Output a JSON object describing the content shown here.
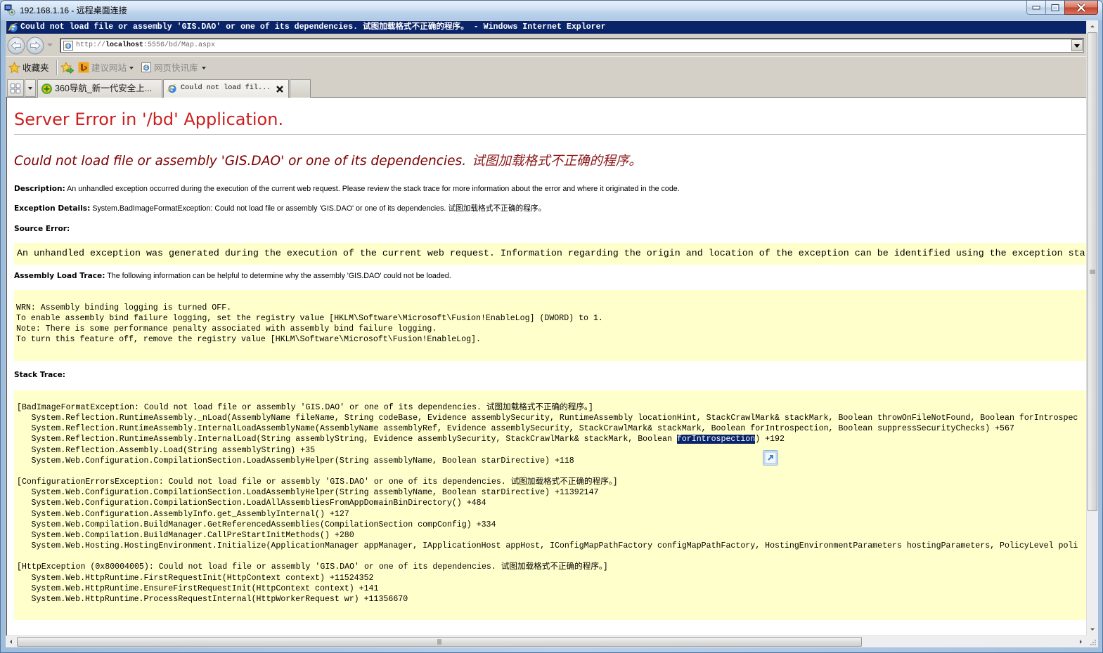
{
  "theme": {
    "heading_color": "#cc1f1f",
    "subheading_color": "#800000",
    "code_box_bg": "#ffffcc",
    "selection_bg": "#0a246a",
    "ie_titlebar_bg": "#0a246a"
  },
  "rdp_window": {
    "title": "192.168.1.16 - 远程桌面连接",
    "controls": [
      "minimize",
      "maximize",
      "close"
    ]
  },
  "ie": {
    "title": "Could not load file or assembly 'GIS.DAO' or one of its dependencies. 试图加载格式不正确的程序。 - Windows Internet Explorer",
    "address_bar": {
      "value": "http://localhost:5556/bd/Map.aspx",
      "scheme": "http://",
      "host": "localhost",
      "rest": ":5556/bd/Map.aspx"
    },
    "favorites_bar": {
      "favorites_label": "收藏夹",
      "items": [
        {
          "label": "建议网站",
          "icon": "bing-icon",
          "has_dropdown": true
        },
        {
          "label": "网页快讯库",
          "icon": "web-slice-gallery-icon",
          "has_dropdown": true
        }
      ]
    },
    "tabs": [
      {
        "label": "360导航_新一代安全上...",
        "icon": "360-icon",
        "active": false
      },
      {
        "label": "Could not load fil...",
        "icon": "ie-page-icon",
        "active": true
      }
    ]
  },
  "page": {
    "heading": "Server Error in '/bd' Application.",
    "error_title": "Could not load file or assembly 'GIS.DAO' or one of its dependencies.",
    "error_title_cn": "试图加载格式不正确的程序。",
    "description": {
      "label": "Description:",
      "text": "An unhandled exception occurred during the execution of the current web request. Please review the stack trace for more information about the error and where it originated in the code."
    },
    "exception_details": {
      "label": "Exception Details:",
      "text": "System.BadImageFormatException: Could not load file or assembly 'GIS.DAO' or one of its dependencies. 试图加载格式不正确的程序。"
    },
    "source_error": {
      "label": "Source Error:",
      "text": "An unhandled exception was generated during the execution of the current web request. Information regarding the origin and location of the exception can be identified using the exception sta"
    },
    "assembly_load_trace": {
      "label": "Assembly Load Trace:",
      "text": "The following information can be helpful to determine why the assembly 'GIS.DAO' could not be loaded.",
      "lines": [
        "WRN: Assembly binding logging is turned OFF.",
        "To enable assembly bind failure logging, set the registry value [HKLM\\Software\\Microsoft\\Fusion!EnableLog] (DWORD) to 1.",
        "Note: There is some performance penalty associated with assembly bind failure logging.",
        "To turn this feature off, remove the registry value [HKLM\\Software\\Microsoft\\Fusion!EnableLog]."
      ]
    },
    "stack_trace": {
      "label": "Stack Trace:",
      "blocks": [
        {
          "header": "[BadImageFormatException: Could not load file or assembly 'GIS.DAO' or one of its dependencies. 试图加载格式不正确的程序。]",
          "frames": [
            "System.Reflection.RuntimeAssembly._nLoad(AssemblyName fileName, String codeBase, Evidence assemblySecurity, RuntimeAssembly locationHint, StackCrawlMark& stackMark, Boolean throwOnFileNotFound, Boolean forIntrospec",
            "System.Reflection.RuntimeAssembly.InternalLoadAssemblyName(AssemblyName assemblyRef, Evidence assemblySecurity, StackCrawlMark& stackMark, Boolean forIntrospection, Boolean suppressSecurityChecks) +567",
            {
              "pre": "System.Reflection.RuntimeAssembly.InternalLoad(String assemblyString, Evidence assemblySecurity, StackCrawlMark& stackMark, Boolean ",
              "selected": "forIntrospection",
              "post": ") +192"
            },
            "System.Reflection.Assembly.Load(String assemblyString) +35",
            "System.Web.Configuration.CompilationSection.LoadAssemblyHelper(String assemblyName, Boolean starDirective) +118"
          ]
        },
        {
          "header": "[ConfigurationErrorsException: Could not load file or assembly 'GIS.DAO' or one of its dependencies. 试图加载格式不正确的程序。]",
          "frames": [
            "System.Web.Configuration.CompilationSection.LoadAssemblyHelper(String assemblyName, Boolean starDirective) +11392147",
            "System.Web.Configuration.CompilationSection.LoadAllAssembliesFromAppDomainBinDirectory() +484",
            "System.Web.Configuration.AssemblyInfo.get_AssemblyInternal() +127",
            "System.Web.Compilation.BuildManager.GetReferencedAssemblies(CompilationSection compConfig) +334",
            "System.Web.Compilation.BuildManager.CallPreStartInitMethods() +280",
            "System.Web.Hosting.HostingEnvironment.Initialize(ApplicationManager appManager, IApplicationHost appHost, IConfigMapPathFactory configMapPathFactory, HostingEnvironmentParameters hostingParameters, PolicyLevel poli"
          ]
        },
        {
          "header": "[HttpException (0x80004005): Could not load file or assembly 'GIS.DAO' or one of its dependencies. 试图加载格式不正确的程序。]",
          "frames": [
            "System.Web.HttpRuntime.FirstRequestInit(HttpContext context) +11524352",
            "System.Web.HttpRuntime.EnsureFirstRequestInit(HttpContext context) +141",
            "System.Web.HttpRuntime.ProcessRequestInternal(HttpWorkerRequest wr) +11356670"
          ]
        }
      ]
    }
  }
}
